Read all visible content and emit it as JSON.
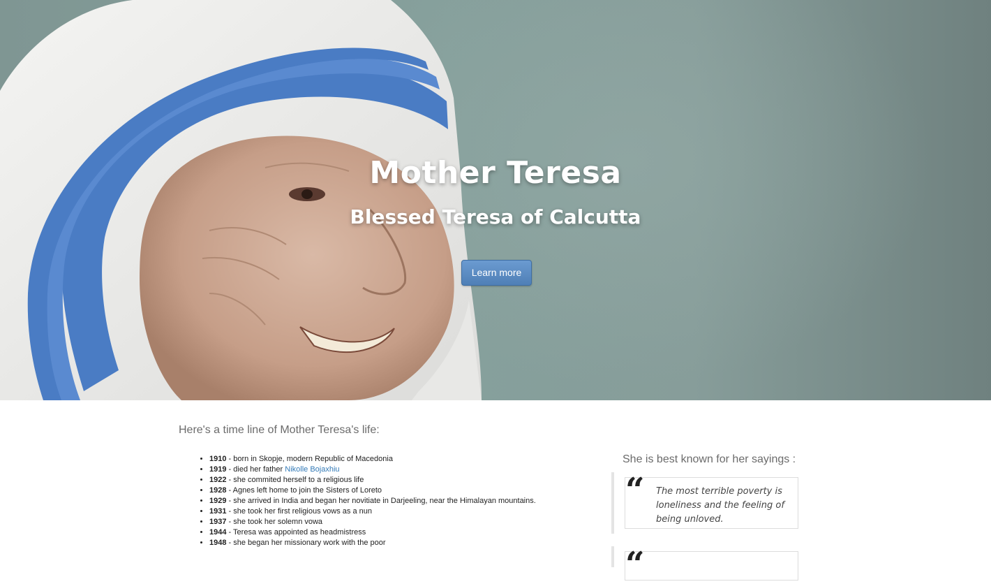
{
  "hero": {
    "title": "Mother Teresa",
    "subtitle": "Blessed Teresa of Calcutta",
    "button_label": "Learn more"
  },
  "timeline": {
    "heading": "Here's a time line of Mother Teresa's life:",
    "items": [
      {
        "year": "1910",
        "text": " - born in Skopje, modern Republic of Macedonia"
      },
      {
        "year": "1919",
        "text": " - died her father ",
        "link": "Nikolle Bojaxhiu"
      },
      {
        "year": "1922",
        "text": " - she commited herself to a religious life"
      },
      {
        "year": "1928",
        "text": " - Agnes left home to join the Sisters of Loreto"
      },
      {
        "year": "1929",
        "text": " - she arrived in India and began her novitiate in Darjeeling, near the Himalayan mountains."
      },
      {
        "year": "1931",
        "text": " - she took her first religious vows as a nun"
      },
      {
        "year": "1937",
        "text": " - she took her solemn vowa"
      },
      {
        "year": "1944",
        "text": " - Teresa was appointed as headmistress"
      },
      {
        "year": "1948",
        "text": " - she began her missionary work with the poor"
      }
    ]
  },
  "sayings": {
    "heading": "She is best known for her sayings :",
    "quote_mark": "“",
    "quotes": [
      {
        "text": "The most terrible poverty is loneliness and the feeling of being unloved."
      }
    ]
  },
  "colors": {
    "hero_bg": "#86a09c",
    "button": "#5b8cc4",
    "link": "#337ab7",
    "veil_blue": "#4a7cc4"
  }
}
